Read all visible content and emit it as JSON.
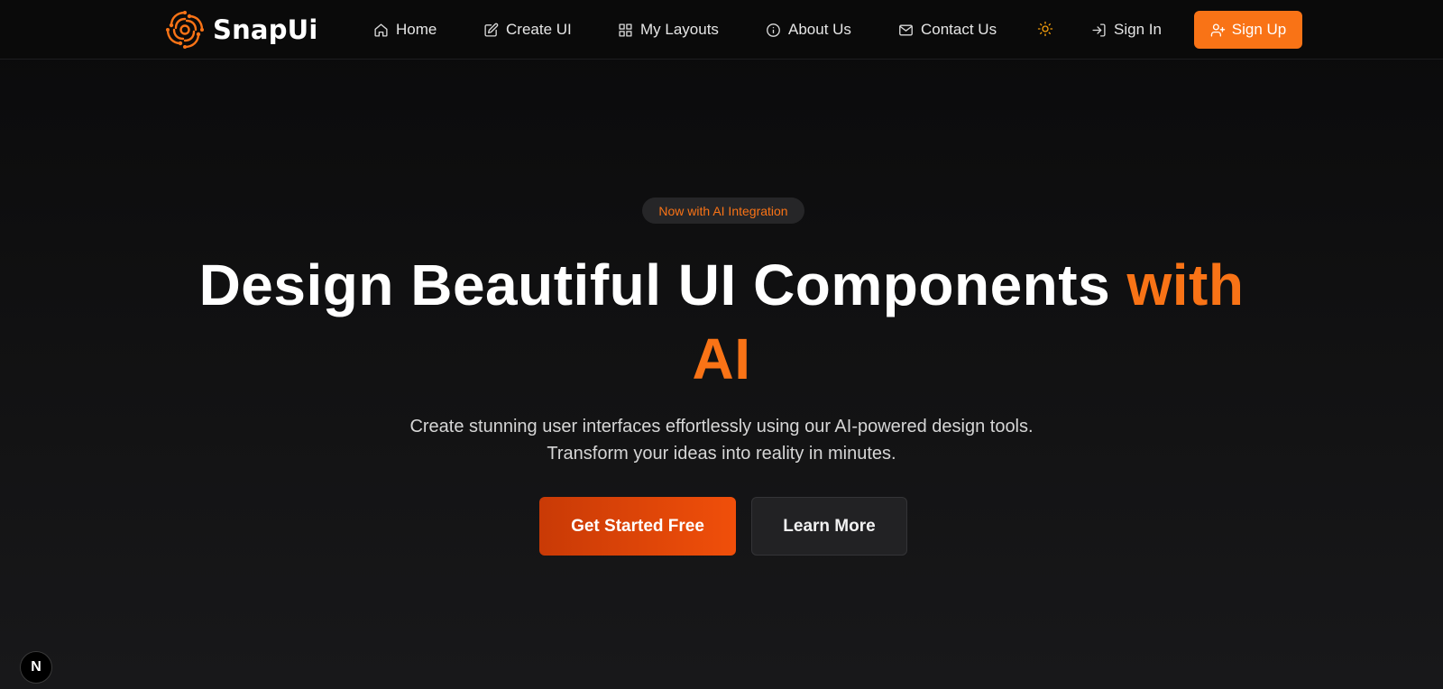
{
  "brand": {
    "name": "SnapUi",
    "logo_icon": "snapui-logo-icon",
    "accent_color": "#f97316"
  },
  "nav": {
    "items": [
      {
        "label": "Home",
        "icon": "home-icon"
      },
      {
        "label": "Create UI",
        "icon": "edit-icon"
      },
      {
        "label": "My Layouts",
        "icon": "grid-icon"
      },
      {
        "label": "About Us",
        "icon": "info-icon"
      },
      {
        "label": "Contact Us",
        "icon": "mail-icon"
      }
    ],
    "theme_toggle_icon": "sun-icon",
    "sign_in": {
      "label": "Sign In",
      "icon": "sign-in-icon"
    },
    "sign_up": {
      "label": "Sign Up",
      "icon": "user-plus-icon"
    }
  },
  "hero": {
    "badge": "Now with AI Integration",
    "title_main": "Design Beautiful UI Components",
    "title_accent_1": "with",
    "title_accent_2": "AI",
    "subtitle": "Create stunning user interfaces effortlessly using our AI-powered design tools. Transform your ideas into reality in minutes.",
    "primary_cta": "Get Started Free",
    "secondary_cta": "Learn More"
  },
  "dev_badge": {
    "label": "N",
    "icon": "nextjs-icon"
  }
}
